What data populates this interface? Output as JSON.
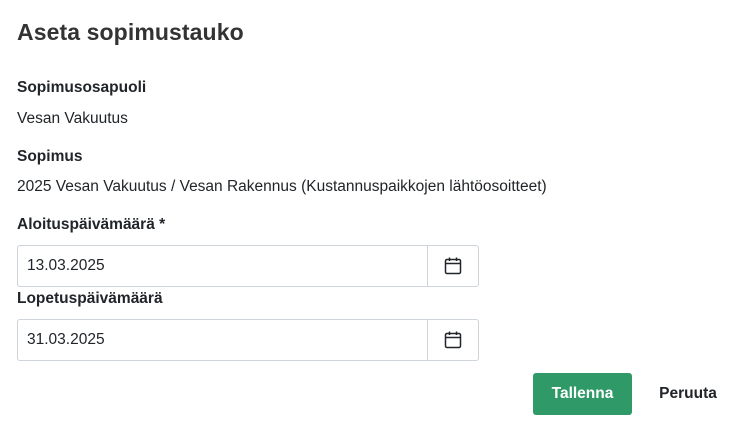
{
  "dialog": {
    "title": "Aseta sopimustauko"
  },
  "fields": {
    "party_label": "Sopimusosapuoli",
    "party_value": "Vesan Vakuutus",
    "contract_label": "Sopimus",
    "contract_value": "2025 Vesan Vakuutus / Vesan Rakennus (Kustannuspaikkojen lähtöosoitteet)",
    "start_label": "Aloituspäivämäärä *",
    "start_value": "13.03.2025",
    "end_label": "Lopetuspäivämäärä",
    "end_value": "31.03.2025"
  },
  "icons": {
    "calendar": "calendar-icon"
  },
  "actions": {
    "save_label": "Tallenna",
    "cancel_label": "Peruuta"
  },
  "colors": {
    "primary": "#2f9a67",
    "border": "#ced4da"
  }
}
